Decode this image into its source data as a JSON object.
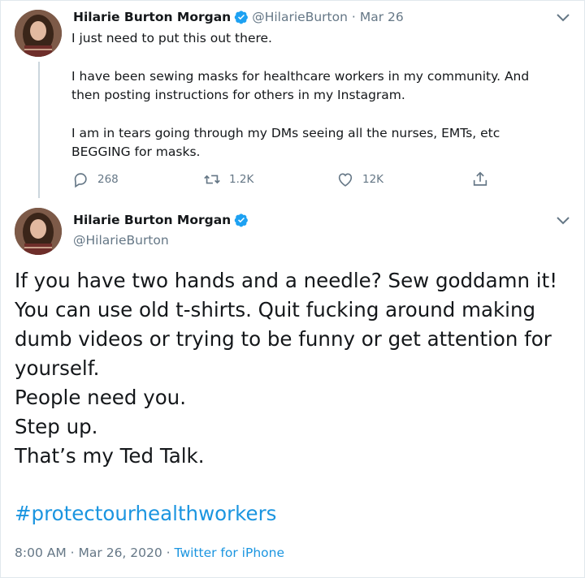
{
  "tweet1": {
    "author_name": "Hilarie Burton Morgan",
    "handle": "@HilarieBurton",
    "separator": "·",
    "date": "Mar 26",
    "paragraphs": [
      [
        "I just need to put this out there."
      ],
      [
        "I have been sewing masks for healthcare workers in my community. And",
        "then posting instructions for others in my Instagram."
      ],
      [
        "I am in tears going through my DMs seeing all the nurses, EMTs, etc",
        "BEGGING for masks."
      ]
    ],
    "actions": {
      "reply_count": "268",
      "retweet_count": "1.2K",
      "like_count": "12K"
    }
  },
  "tweet2": {
    "author_name": "Hilarie Burton Morgan",
    "handle": "@HilarieBurton",
    "lines": [
      "If you have two hands and a needle? Sew goddamn it!",
      "You can use old t-shirts. Quit fucking around making",
      "dumb videos or trying to be funny or get attention for",
      "yourself.",
      "People need you.",
      "Step up.",
      "That’s my Ted Talk."
    ],
    "hashtag": "#protectourhealthworkers",
    "time": "8:00 AM",
    "separator": "·",
    "date": "Mar 26, 2020",
    "source": "Twitter for iPhone"
  },
  "colors": {
    "text": "#14171a",
    "muted": "#657786",
    "link": "#1b95e0",
    "verified": "#1da1f2",
    "border": "#e1e8ed"
  },
  "icons": [
    "avatar",
    "verified-badge-icon",
    "chevron-down-icon",
    "reply-icon",
    "retweet-icon",
    "like-icon",
    "share-icon"
  ]
}
